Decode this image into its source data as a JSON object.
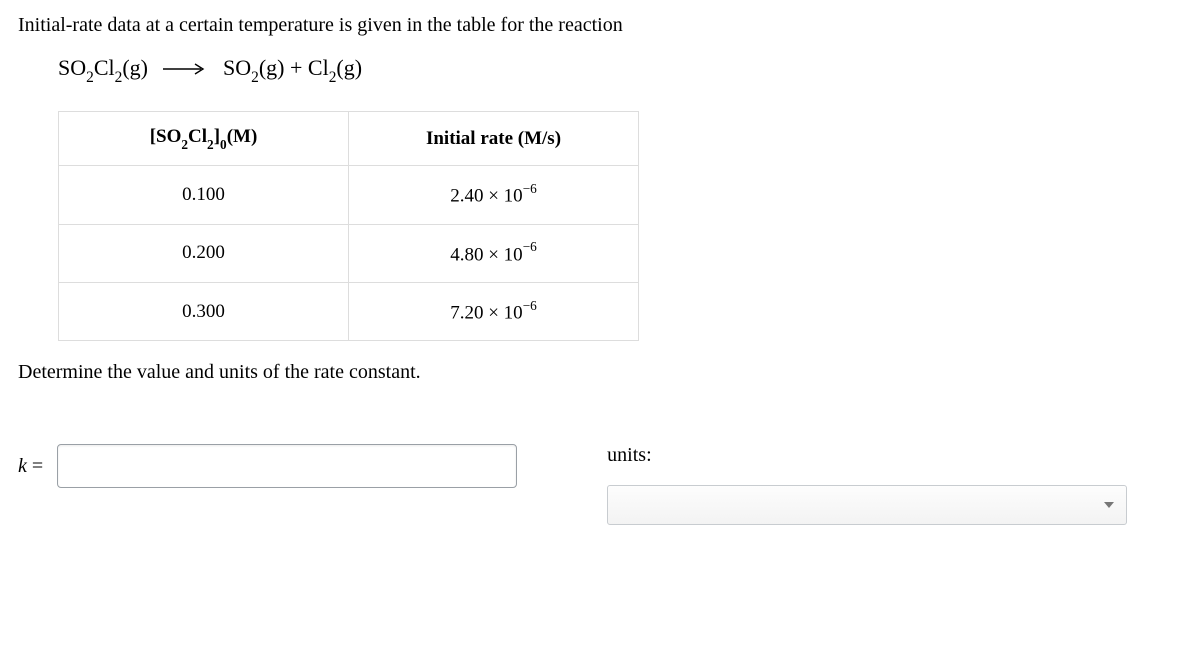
{
  "intro": "Initial-rate data at a certain temperature is given in the table for the reaction",
  "equation": {
    "lhs_species": "SO",
    "lhs_sub1": "2",
    "lhs_cl": "Cl",
    "lhs_sub2": "2",
    "lhs_phase": "(g)",
    "rhs1_species": "SO",
    "rhs1_sub": "2",
    "rhs1_phase": "(g)",
    "plus": " + ",
    "rhs2_species": "Cl",
    "rhs2_sub": "2",
    "rhs2_phase": "(g)"
  },
  "table": {
    "header_col1_pre": "[SO",
    "header_col1_sub1": "2",
    "header_col1_mid": "Cl",
    "header_col1_sub2": "2",
    "header_col1_post": "]",
    "header_col1_sub3": "0",
    "header_col1_unit": "(M)",
    "header_col2": "Initial rate (M/s)",
    "rows": [
      {
        "conc": "0.100",
        "rate_mant": "2.40 × 10",
        "rate_exp": "−6"
      },
      {
        "conc": "0.200",
        "rate_mant": "4.80 × 10",
        "rate_exp": "−6"
      },
      {
        "conc": "0.300",
        "rate_mant": "7.20 × 10",
        "rate_exp": "−6"
      }
    ]
  },
  "question": "Determine the value and units of the rate constant.",
  "answer": {
    "k_label_italic": "k",
    "k_label_eq": " =",
    "k_value": "",
    "units_label": "units:",
    "units_value": ""
  }
}
